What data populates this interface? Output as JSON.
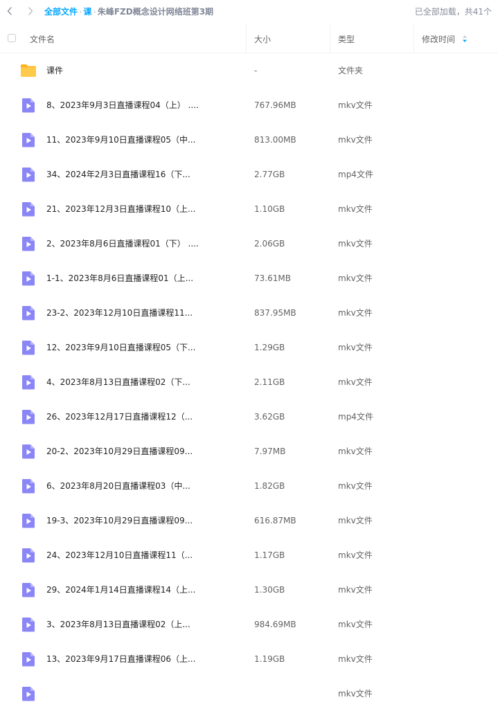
{
  "breadcrumb": {
    "root": "全部文件",
    "sep": "›",
    "level1": "课",
    "current": "朱峰FZD概念设计网络班第3期"
  },
  "load_status": "已全部加载，共41个",
  "columns": {
    "name": "文件名",
    "size": "大小",
    "type": "类型",
    "modified": "修改时间"
  },
  "files": [
    {
      "icon": "folder-icon",
      "name": "课件",
      "size": "-",
      "type": "文件夹"
    },
    {
      "icon": "video-icon",
      "name": "8、2023年9月3日直播课程04（上） ....",
      "size": "767.96MB",
      "type": "mkv文件"
    },
    {
      "icon": "video-icon",
      "name": "11、2023年9月10日直播课程05（中...",
      "size": "813.00MB",
      "type": "mkv文件"
    },
    {
      "icon": "video-icon",
      "name": "34、2024年2月3日直播课程16（下...",
      "size": "2.77GB",
      "type": "mp4文件"
    },
    {
      "icon": "video-icon",
      "name": "21、2023年12月3日直播课程10（上...",
      "size": "1.10GB",
      "type": "mkv文件"
    },
    {
      "icon": "video-icon",
      "name": "2、2023年8月6日直播课程01（下） ....",
      "size": "2.06GB",
      "type": "mkv文件"
    },
    {
      "icon": "video-icon",
      "name": "1-1、2023年8月6日直播课程01（上...",
      "size": "73.61MB",
      "type": "mkv文件"
    },
    {
      "icon": "video-icon",
      "name": "23-2、2023年12月10日直播课程11...",
      "size": "837.95MB",
      "type": "mkv文件"
    },
    {
      "icon": "video-icon",
      "name": "12、2023年9月10日直播课程05（下...",
      "size": "1.29GB",
      "type": "mkv文件"
    },
    {
      "icon": "video-icon",
      "name": "4、2023年8月13日直播课程02（下...",
      "size": "2.11GB",
      "type": "mkv文件"
    },
    {
      "icon": "video-icon",
      "name": "26、2023年12月17日直播课程12（...",
      "size": "3.62GB",
      "type": "mp4文件"
    },
    {
      "icon": "video-icon",
      "name": "20-2、2023年10月29日直播课程09...",
      "size": "7.97MB",
      "type": "mkv文件"
    },
    {
      "icon": "video-icon",
      "name": "6、2023年8月20日直播课程03（中...",
      "size": "1.82GB",
      "type": "mkv文件"
    },
    {
      "icon": "video-icon",
      "name": "19-3、2023年10月29日直播课程09...",
      "size": "616.87MB",
      "type": "mkv文件"
    },
    {
      "icon": "video-icon",
      "name": "24、2023年12月10日直播课程11（...",
      "size": "1.17GB",
      "type": "mkv文件"
    },
    {
      "icon": "video-icon",
      "name": "29、2024年1月14日直播课程14（上...",
      "size": "1.30GB",
      "type": "mkv文件"
    },
    {
      "icon": "video-icon",
      "name": "3、2023年8月13日直播课程02（上...",
      "size": "984.69MB",
      "type": "mkv文件"
    },
    {
      "icon": "video-icon",
      "name": "13、2023年9月17日直播课程06（上...",
      "size": "1.19GB",
      "type": "mkv文件"
    },
    {
      "icon": "video-icon",
      "name": "",
      "size": "",
      "type": "mkv文件"
    }
  ],
  "colors": {
    "accent": "#06a7ff",
    "video_icon": "#8b86f6",
    "folder_icon": "#ffc23b"
  }
}
